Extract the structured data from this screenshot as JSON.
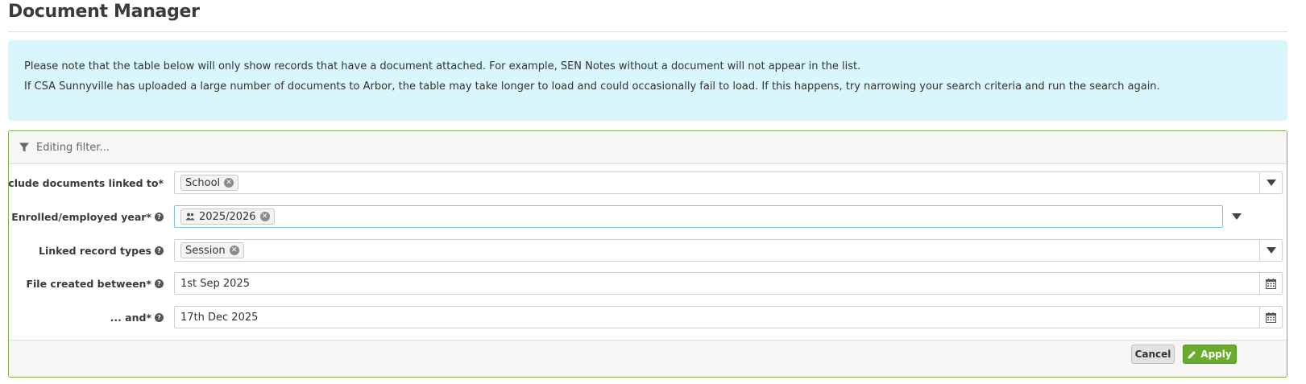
{
  "page": {
    "title": "Document Manager"
  },
  "notice": {
    "line1": "Please note that the table below will only show records that have a document attached. For example, SEN Notes without a document will not appear in the list.",
    "line2": "If CSA Sunnyville has uploaded a large number of documents to Arbor, the table may take longer to load and could occasionally fail to load. If this happens, try narrowing your search criteria and run the search again."
  },
  "filter": {
    "header": "Editing filter...",
    "rows": [
      {
        "label": "Include documents linked to*",
        "help": false,
        "kind": "tags",
        "tags": [
          "School"
        ],
        "tail": "chevron-down-icon"
      },
      {
        "label": "Enrolled/employed year*",
        "help": true,
        "kind": "tags",
        "tags": [
          "2025/2026"
        ],
        "tag_icon": "users-icon",
        "tail": "chevron-down-icon"
      },
      {
        "label": "Linked record types",
        "help": true,
        "kind": "tags",
        "tags": [
          "Session"
        ],
        "tail": "chevron-down-icon"
      },
      {
        "label": "File created between*",
        "help": true,
        "kind": "date",
        "value": "1st Sep 2025",
        "tail": "calendar-icon"
      },
      {
        "label": "... and*",
        "help": true,
        "kind": "date",
        "value": "17th Dec 2025",
        "tail": "calendar-icon"
      }
    ],
    "cancel_label": "Cancel",
    "apply_label": "Apply"
  },
  "colors": {
    "notice_bg": "#d8f6fb",
    "panel_border": "#7fae4d",
    "apply_bg": "#6aaa2f"
  }
}
